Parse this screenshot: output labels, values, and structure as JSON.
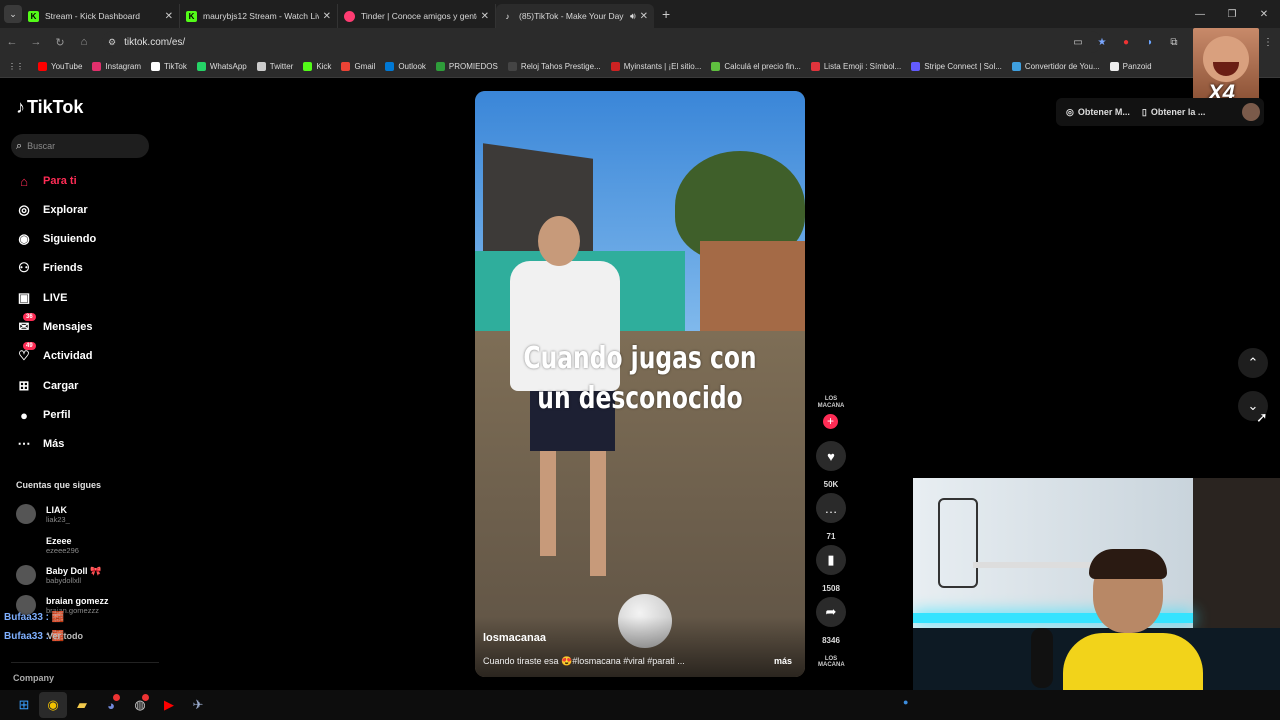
{
  "browser": {
    "tabs": [
      {
        "title": "Stream - Kick Dashboard",
        "icon": "kick-icon",
        "color": "#53fc18"
      },
      {
        "title": "maurybjs12 Stream - Watch Live",
        "icon": "kick-icon",
        "color": "#53fc18"
      },
      {
        "title": "Tinder | Conoce amigos y gente",
        "icon": "tinder-icon",
        "color": "#fe3c72"
      },
      {
        "title": "(85)TikTok - Make Your Day",
        "icon": "tiktok-icon",
        "color": "#ffffff"
      }
    ],
    "url": "tiktok.com/es/",
    "bookmarks": [
      {
        "label": "YouTube",
        "color": "#ff0000"
      },
      {
        "label": "Instagram",
        "color": "#e1306c"
      },
      {
        "label": "TikTok",
        "color": "#ffffff"
      },
      {
        "label": "WhatsApp",
        "color": "#25d366"
      },
      {
        "label": "Twitter",
        "color": "#cccccc"
      },
      {
        "label": "Kick",
        "color": "#53fc18"
      },
      {
        "label": "Gmail",
        "color": "#ea4335"
      },
      {
        "label": "Outlook",
        "color": "#0078d4"
      },
      {
        "label": "PROMIEDOS",
        "color": "#2e9d3a"
      },
      {
        "label": "Reloj Tahos Prestige...",
        "color": "#444444"
      },
      {
        "label": "Myinstants | ¡El sitio...",
        "color": "#cc2222"
      },
      {
        "label": "Calculá el precio fin...",
        "color": "#5fbf3f"
      },
      {
        "label": "Lista Emoji : Símbol...",
        "color": "#e0343c"
      },
      {
        "label": "Stripe Connect | Sol...",
        "color": "#635bff"
      },
      {
        "label": "Convertidor de You...",
        "color": "#3fa0e0"
      },
      {
        "label": "Panzoid",
        "color": "#eeeeee"
      }
    ],
    "emote_text": "X4"
  },
  "sidebar": {
    "logo": "TikTok",
    "search_placeholder": "Buscar",
    "nav": [
      {
        "label": "Para ti",
        "icon": "home-icon",
        "active": true,
        "badge": ""
      },
      {
        "label": "Explorar",
        "icon": "compass-icon",
        "active": false,
        "badge": ""
      },
      {
        "label": "Siguiendo",
        "icon": "following-icon",
        "active": false,
        "badge": ""
      },
      {
        "label": "Friends",
        "icon": "friends-icon",
        "active": false,
        "badge": ""
      },
      {
        "label": "LIVE",
        "icon": "live-icon",
        "active": false,
        "badge": ""
      },
      {
        "label": "Mensajes",
        "icon": "messages-icon",
        "active": false,
        "badge": "36"
      },
      {
        "label": "Actividad",
        "icon": "activity-icon",
        "active": false,
        "badge": "49"
      },
      {
        "label": "Cargar",
        "icon": "upload-icon",
        "active": false,
        "badge": ""
      },
      {
        "label": "Perfil",
        "icon": "profile-icon",
        "active": false,
        "badge": ""
      },
      {
        "label": "Más",
        "icon": "more-icon",
        "active": false,
        "badge": ""
      }
    ],
    "following_title": "Cuentas que sigues",
    "following": [
      {
        "name": "LIAK",
        "handle": "liak23_"
      },
      {
        "name": "Ezeee",
        "handle": "ezeee296"
      },
      {
        "name": "Baby Doll 🎀",
        "handle": "babydollxll"
      },
      {
        "name": "braian gomezz",
        "handle": "braian.gomezzz"
      }
    ],
    "see_all": "Ver todo",
    "company": "Company",
    "chat_lines": [
      "Bufaa33 : 🧱",
      "Bufaa33 : 🧱"
    ]
  },
  "video": {
    "overlay_text": "Cuando jugas con un desconocido",
    "username": "losmacanaa",
    "description": "Cuando tiraste esa 😍#losmacana #viral #parati ...",
    "more": "más",
    "creator_tag": "LOS MACANA",
    "music_tag": "LOS MACANA",
    "likes": "50K",
    "comments": "71",
    "saves": "1508",
    "shares": "8346"
  },
  "topbar": {
    "get_coins": "Obtener M...",
    "get_app": "Obtener la ..."
  }
}
